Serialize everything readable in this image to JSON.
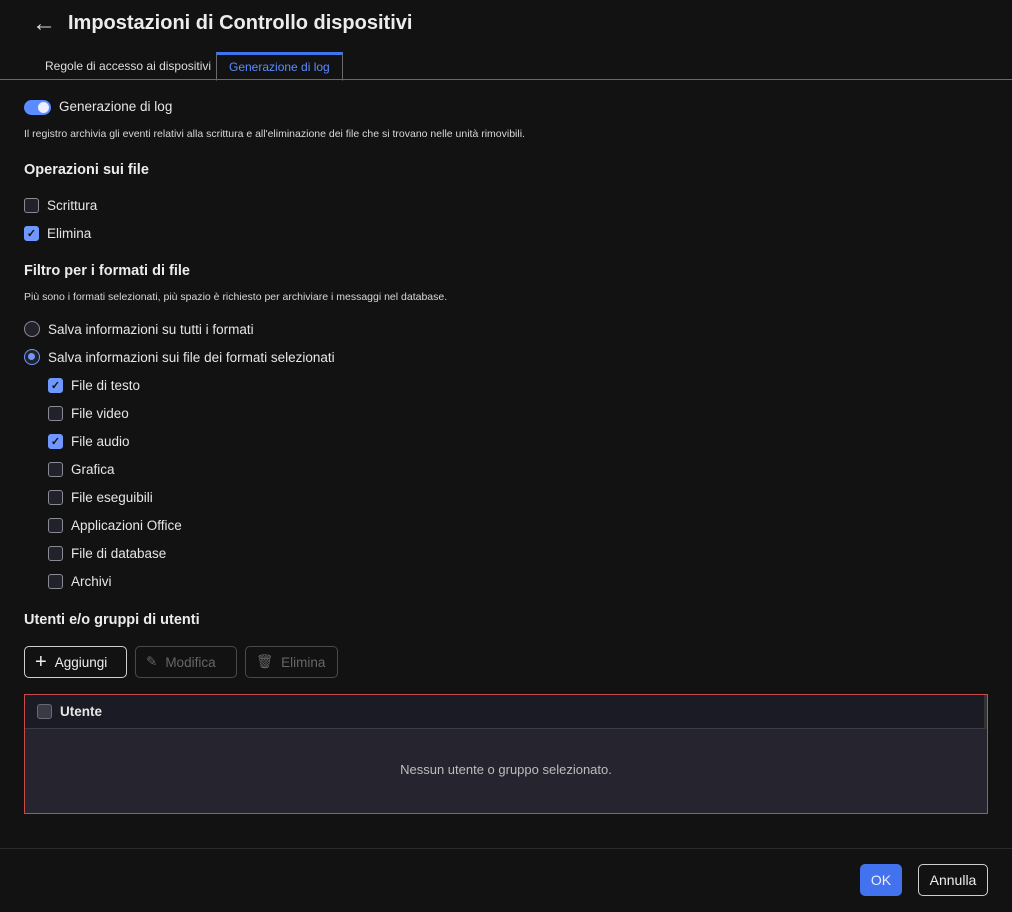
{
  "header": {
    "title": "Impostazioni di Controllo dispositivi"
  },
  "tabs": [
    {
      "label": "Regole di accesso ai dispositivi",
      "active": false
    },
    {
      "label": "Generazione di log",
      "active": true
    }
  ],
  "logging": {
    "toggle_label": "Generazione di log",
    "enabled": true,
    "description": "Il registro archivia gli eventi relativi alla scrittura e all'eliminazione dei file che si trovano nelle unità rimovibili."
  },
  "file_ops": {
    "heading": "Operazioni sui file",
    "items": [
      {
        "label": "Scrittura",
        "checked": false
      },
      {
        "label": "Elimina",
        "checked": true
      }
    ]
  },
  "format_filter": {
    "heading": "Filtro per i formati di file",
    "description": "Più sono i formati selezionati, più spazio è richiesto per archiviare i messaggi nel database.",
    "radios": [
      {
        "label": "Salva informazioni su tutti i formati",
        "selected": false
      },
      {
        "label": "Salva informazioni sui file dei formati selezionati",
        "selected": true
      }
    ],
    "formats": [
      {
        "label": "File di testo",
        "checked": true
      },
      {
        "label": "File video",
        "checked": false
      },
      {
        "label": "File audio",
        "checked": true
      },
      {
        "label": "Grafica",
        "checked": false
      },
      {
        "label": "File eseguibili",
        "checked": false
      },
      {
        "label": "Applicazioni Office",
        "checked": false
      },
      {
        "label": "File di database",
        "checked": false
      },
      {
        "label": "Archivi",
        "checked": false
      }
    ]
  },
  "users": {
    "heading": "Utenti e/o gruppi di utenti",
    "add_label": "Aggiungi",
    "edit_label": "Modifica",
    "delete_label": "Elimina",
    "column": "Utente",
    "empty": "Nessun utente o gruppo selezionato."
  },
  "footer": {
    "ok_label": "OK",
    "cancel_label": "Annulla"
  },
  "colors": {
    "accent": "#4272ee",
    "error_border": "#c94a4a"
  }
}
